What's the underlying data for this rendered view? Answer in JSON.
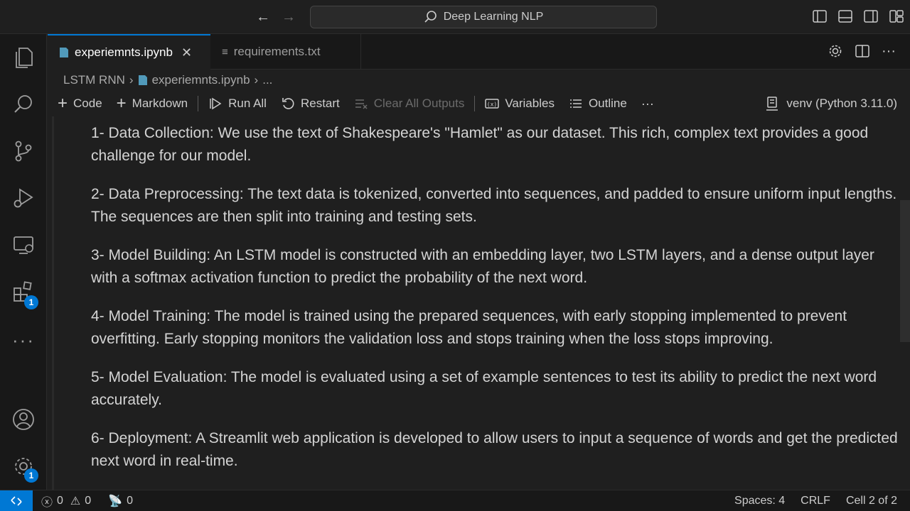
{
  "titlebar": {
    "search_text": "Deep Learning NLP"
  },
  "activity": {
    "extensions_badge": "1",
    "settings_badge": "1"
  },
  "tabs": [
    {
      "label": "experiemnts.ipynb",
      "active": true
    },
    {
      "label": "requirements.txt",
      "active": false
    }
  ],
  "breadcrumb": {
    "folder": "LSTM RNN",
    "file": "experiemnts.ipynb",
    "more": "..."
  },
  "toolbar": {
    "code": "Code",
    "markdown": "Markdown",
    "run_all": "Run All",
    "restart": "Restart",
    "clear_outputs": "Clear All Outputs",
    "variables": "Variables",
    "outline": "Outline",
    "more": "···",
    "kernel": "venv (Python 3.11.0)"
  },
  "content": {
    "paragraphs": [
      "1- Data Collection: We use the text of Shakespeare's \"Hamlet\" as our dataset. This rich, complex text provides a good challenge for our model.",
      "2- Data Preprocessing: The text data is tokenized, converted into sequences, and padded to ensure uniform input lengths. The sequences are then split into training and testing sets.",
      "3- Model Building: An LSTM model is constructed with an embedding layer, two LSTM layers, and a dense output layer with a softmax activation function to predict the probability of the next word.",
      "4- Model Training: The model is trained using the prepared sequences, with early stopping implemented to prevent overfitting. Early stopping monitors the validation loss and stops training when the loss stops improving.",
      "5- Model Evaluation: The model is evaluated using a set of example sentences to test its ability to predict the next word accurately.",
      "6- Deployment: A Streamlit web application is developed to allow users to input a sequence of words and get the predicted next word in real-time."
    ]
  },
  "statusbar": {
    "errors": "0",
    "warnings": "0",
    "ports": "0",
    "spaces": "Spaces: 4",
    "eol": "CRLF",
    "cell": "Cell 2 of 2"
  },
  "colors": {
    "accent": "#0078d4",
    "background": "#1f1f1f",
    "sidebar": "#181818"
  }
}
